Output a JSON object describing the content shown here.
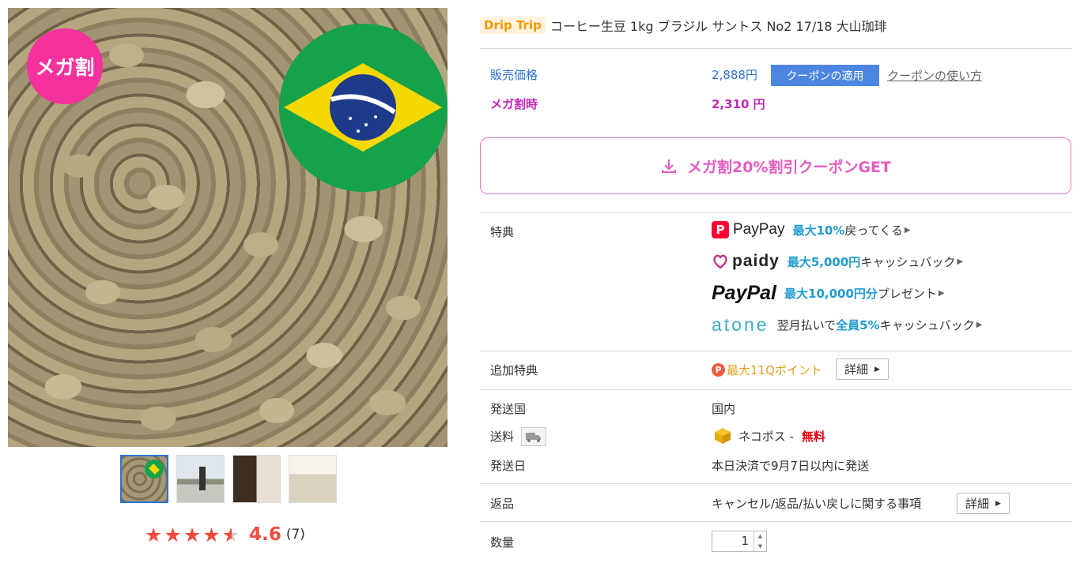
{
  "gallery": {
    "badge": "メガ割",
    "thumbs": [
      "thumb-1",
      "thumb-2",
      "thumb-3",
      "thumb-4"
    ]
  },
  "rating": {
    "value": 4.6,
    "score_text": "4.6",
    "count_text": "(7)",
    "stars_max": 5
  },
  "product": {
    "shop_badge": "Drip Trip",
    "title": "コーヒー生豆 1kg ブラジル サントス No2 17/18 大山珈琲"
  },
  "price": {
    "label": "販売価格",
    "value": "2,888円",
    "coupon_apply": "クーポンの適用",
    "coupon_howto": "クーポンの使い方",
    "mega_label": "メガ割時",
    "mega_value": "2,310 円"
  },
  "coupon_button": "メガ割20%割引クーポンGET",
  "perks": {
    "label": "特典",
    "items": [
      {
        "logo": "PayPay",
        "highlight": "最大10%",
        "text": "戻ってくる"
      },
      {
        "logo": "paidy",
        "highlight": "最大5,000円",
        "text": "キャッシュバック"
      },
      {
        "logo": "PayPal",
        "highlight": "最大10,000円分",
        "text": "プレゼント"
      },
      {
        "logo": "atone",
        "prefix": "翌月払いで",
        "highlight": "全員5%",
        "text": "キャッシュバック"
      }
    ]
  },
  "extra_perks": {
    "label": "追加特典",
    "points": "最大11Qポイント",
    "detail": "詳細"
  },
  "shipping": {
    "country_label": "発送国",
    "country_value": "国内",
    "fee_label": "送料",
    "method": "ネコポス - ",
    "free": "無料",
    "date_label": "発送日",
    "date_value": "本日決済で9月7日以内に発送"
  },
  "returns": {
    "label": "返品",
    "value": "キャンセル/返品/払い戻しに関する事項",
    "detail": "詳細"
  },
  "quantity": {
    "label": "数量",
    "value": "1"
  },
  "colors": {
    "accent_blue": "#2e72d2",
    "mega_purple": "#c22ab8",
    "coupon_pink": "#e65cc0",
    "highlight_blue": "#1f9bd1",
    "free_red": "#e60012",
    "rating_red": "#f04b3e",
    "brand_orange": "#f39800"
  },
  "icons": [
    "download-icon",
    "truck-icon",
    "box-icon",
    "point-icon",
    "triangle-right-icon",
    "star-icon"
  ]
}
